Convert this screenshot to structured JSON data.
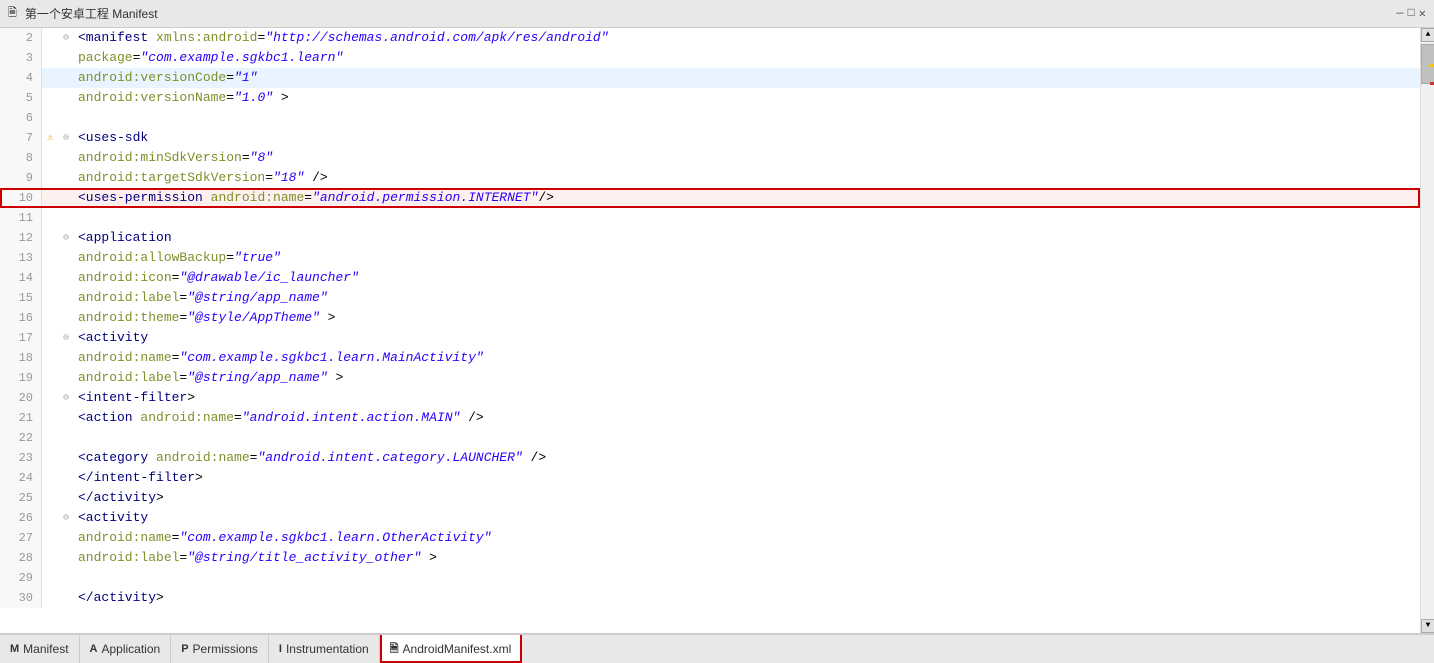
{
  "title": {
    "text": "第一个安卓工程 Manifest",
    "close_label": "✕"
  },
  "editor": {
    "lines": [
      {
        "num": 2,
        "fold": "⊖",
        "icon": "",
        "code": "<manifest xmlns:android=\"http://schemas.android.com/apk/res/android\"",
        "highlight": false,
        "cursor": false
      },
      {
        "num": 3,
        "fold": "",
        "icon": "",
        "code": "    package=\"com.example.sgkbc1.learn\"",
        "highlight": false,
        "cursor": false
      },
      {
        "num": 4,
        "fold": "",
        "icon": "",
        "code": "    android:versionCode=\"1\"",
        "highlight": false,
        "cursor": true
      },
      {
        "num": 5,
        "fold": "",
        "icon": "",
        "code": "    android:versionName=\"1.0\" >",
        "highlight": false,
        "cursor": false
      },
      {
        "num": 6,
        "fold": "",
        "icon": "",
        "code": "",
        "highlight": false,
        "cursor": false
      },
      {
        "num": 7,
        "fold": "⊖",
        "icon": "⚠",
        "code": "    <uses-sdk",
        "highlight": false,
        "cursor": false
      },
      {
        "num": 8,
        "fold": "",
        "icon": "",
        "code": "        android:minSdkVersion=\"8\"",
        "highlight": false,
        "cursor": false
      },
      {
        "num": 9,
        "fold": "",
        "icon": "",
        "code": "        android:targetSdkVersion=\"18\" />",
        "highlight": false,
        "cursor": false
      },
      {
        "num": 10,
        "fold": "",
        "icon": "",
        "code": "    <uses-permission android:name=\"android.permission.INTERNET\"/>",
        "highlight": true,
        "cursor": false
      },
      {
        "num": 11,
        "fold": "",
        "icon": "",
        "code": "",
        "highlight": false,
        "cursor": false
      },
      {
        "num": 12,
        "fold": "⊖",
        "icon": "",
        "code": "    <application",
        "highlight": false,
        "cursor": false
      },
      {
        "num": 13,
        "fold": "",
        "icon": "",
        "code": "        android:allowBackup=\"true\"",
        "highlight": false,
        "cursor": false
      },
      {
        "num": 14,
        "fold": "",
        "icon": "",
        "code": "        android:icon=\"@drawable/ic_launcher\"",
        "highlight": false,
        "cursor": false
      },
      {
        "num": 15,
        "fold": "",
        "icon": "",
        "code": "        android:label=\"@string/app_name\"",
        "highlight": false,
        "cursor": false
      },
      {
        "num": 16,
        "fold": "",
        "icon": "",
        "code": "        android:theme=\"@style/AppTheme\" >",
        "highlight": false,
        "cursor": false
      },
      {
        "num": 17,
        "fold": "⊖",
        "icon": "",
        "code": "        <activity",
        "highlight": false,
        "cursor": false
      },
      {
        "num": 18,
        "fold": "",
        "icon": "",
        "code": "            android:name=\"com.example.sgkbc1.learn.MainActivity\"",
        "highlight": false,
        "cursor": false
      },
      {
        "num": 19,
        "fold": "",
        "icon": "",
        "code": "            android:label=\"@string/app_name\" >",
        "highlight": false,
        "cursor": false
      },
      {
        "num": 20,
        "fold": "⊖",
        "icon": "",
        "code": "            <intent-filter>",
        "highlight": false,
        "cursor": false
      },
      {
        "num": 21,
        "fold": "",
        "icon": "",
        "code": "                <action android:name=\"android.intent.action.MAIN\" />",
        "highlight": false,
        "cursor": false
      },
      {
        "num": 22,
        "fold": "",
        "icon": "",
        "code": "",
        "highlight": false,
        "cursor": false
      },
      {
        "num": 23,
        "fold": "",
        "icon": "",
        "code": "                <category android:name=\"android.intent.category.LAUNCHER\" />",
        "highlight": false,
        "cursor": false
      },
      {
        "num": 24,
        "fold": "",
        "icon": "",
        "code": "            </intent-filter>",
        "highlight": false,
        "cursor": false
      },
      {
        "num": 25,
        "fold": "",
        "icon": "",
        "code": "        </activity>",
        "highlight": false,
        "cursor": false
      },
      {
        "num": 26,
        "fold": "⊖",
        "icon": "",
        "code": "        <activity",
        "highlight": false,
        "cursor": false
      },
      {
        "num": 27,
        "fold": "",
        "icon": "",
        "code": "            android:name=\"com.example.sgkbc1.learn.OtherActivity\"",
        "highlight": false,
        "cursor": false
      },
      {
        "num": 28,
        "fold": "",
        "icon": "",
        "code": "            android:label=\"@string/title_activity_other\" >",
        "highlight": false,
        "cursor": false
      },
      {
        "num": 29,
        "fold": "",
        "icon": "",
        "code": "",
        "highlight": false,
        "cursor": false
      },
      {
        "num": 30,
        "fold": "",
        "icon": "",
        "code": "        </activity>",
        "highlight": false,
        "cursor": false
      }
    ]
  },
  "tabs": [
    {
      "id": "manifest",
      "icon": "M",
      "label": "Manifest",
      "highlighted": false,
      "active": false
    },
    {
      "id": "application",
      "icon": "A",
      "label": "Application",
      "highlighted": false,
      "active": false
    },
    {
      "id": "permissions",
      "icon": "P",
      "label": "Permissions",
      "highlighted": false,
      "active": false
    },
    {
      "id": "instrumentation",
      "icon": "I",
      "label": "Instrumentation",
      "highlighted": false,
      "active": false
    },
    {
      "id": "androidmanifest",
      "icon": "🗎",
      "label": "AndroidManifest.xml",
      "highlighted": true,
      "active": true
    }
  ],
  "scrollbar": {
    "up_arrow": "▲",
    "down_arrow": "▼"
  }
}
